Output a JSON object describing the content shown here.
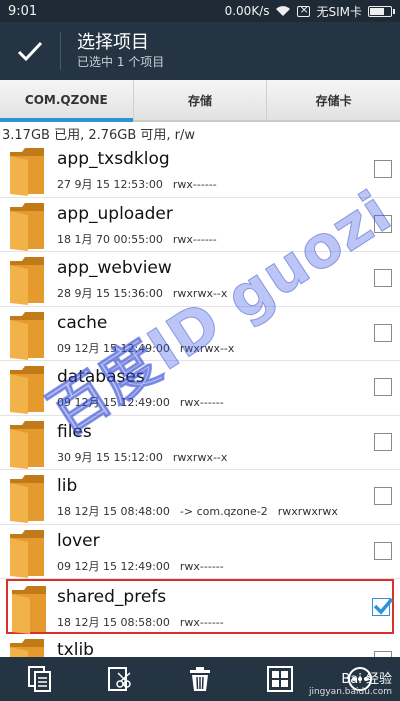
{
  "status_bar": {
    "time": "9:01",
    "network_speed": "0.00K/s",
    "sim_status": "无SIM卡"
  },
  "action_bar": {
    "title": "选择项目",
    "subtitle": "已选中 1 个项目"
  },
  "tabs": [
    {
      "label": "COM.QZONE",
      "active": true
    },
    {
      "label": "存储",
      "active": false
    },
    {
      "label": "存储卡",
      "active": false
    }
  ],
  "storage_info": "3.17GB 已用, 2.76GB 可用, r/w",
  "files": [
    {
      "name": "app_txsdklog",
      "date": "27 9月 15 12:53:00",
      "perms": "rwx------",
      "link": "",
      "checked": false
    },
    {
      "name": "app_uploader",
      "date": "18 1月 70 00:55:00",
      "perms": "rwx------",
      "link": "",
      "checked": false
    },
    {
      "name": "app_webview",
      "date": "28 9月 15 15:36:00",
      "perms": "rwxrwx--x",
      "link": "",
      "checked": false
    },
    {
      "name": "cache",
      "date": "09 12月 15 12:49:00",
      "perms": "rwxrwx--x",
      "link": "",
      "checked": false
    },
    {
      "name": "databases",
      "date": "09 12月 15 12:49:00",
      "perms": "rwx------",
      "link": "",
      "checked": false
    },
    {
      "name": "files",
      "date": "30 9月 15 15:12:00",
      "perms": "rwxrwx--x",
      "link": "",
      "checked": false
    },
    {
      "name": "lib",
      "date": "18 12月 15 08:48:00",
      "perms": "rwxrwxrwx",
      "link": "-> com.qzone-2",
      "checked": false
    },
    {
      "name": "lover",
      "date": "09 12月 15 12:49:00",
      "perms": "rwx------",
      "link": "",
      "checked": false
    },
    {
      "name": "shared_prefs",
      "date": "18 12月 15 08:58:00",
      "perms": "rwx------",
      "link": "",
      "checked": true
    },
    {
      "name": "txlib",
      "date": "",
      "perms": "",
      "link": "",
      "checked": false
    }
  ],
  "watermark": "百度ID guozi",
  "baidu_mark": {
    "line1": "Bai 经验",
    "line2": "jingyan.baidu.com"
  },
  "colors": {
    "bar": "#243443",
    "accent": "#2e93d6",
    "folder": "#e49a2d",
    "highlight": "#d9302b"
  },
  "bottom_bar_icons": [
    "copy-icon",
    "cut-icon",
    "delete-icon",
    "select-all-icon",
    "more-icon"
  ]
}
